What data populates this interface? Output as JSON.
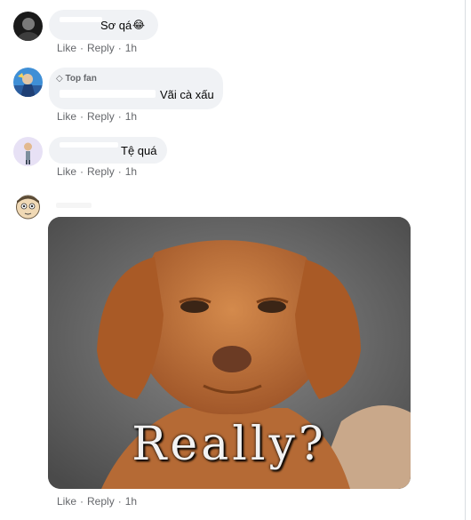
{
  "comments": [
    {
      "text": "Sơ qá",
      "emoji": "😂",
      "actions": {
        "like": "Like",
        "reply": "Reply",
        "time": "1h"
      }
    },
    {
      "badge": "Top fan",
      "text": "Vãi cà xấu",
      "actions": {
        "like": "Like",
        "reply": "Reply",
        "time": "1h"
      }
    },
    {
      "text": "Tệ quá",
      "actions": {
        "like": "Like",
        "reply": "Reply",
        "time": "1h"
      }
    },
    {
      "gif_caption": "Really?",
      "actions": {
        "like": "Like",
        "reply": "Reply",
        "time": "1h"
      }
    }
  ],
  "colors": {
    "bubble": "#f0f2f5",
    "meta": "#65676b",
    "text": "#050505"
  }
}
